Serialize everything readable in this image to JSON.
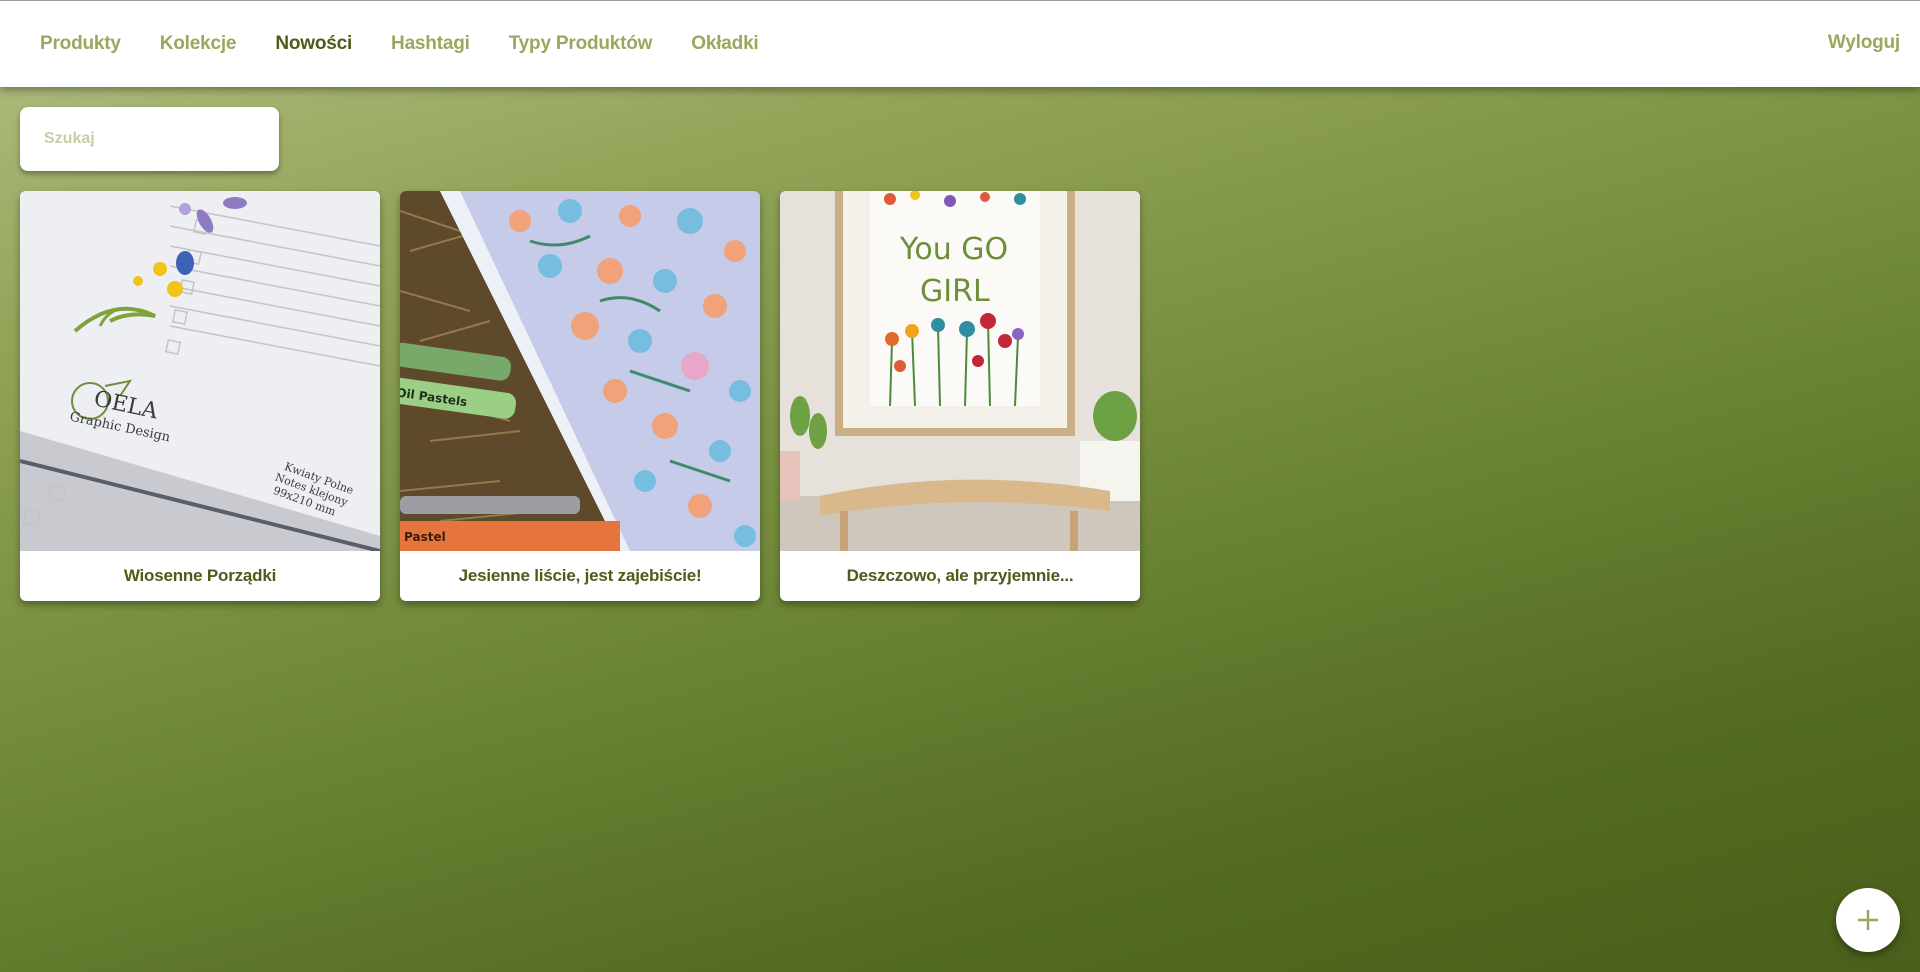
{
  "nav": {
    "items": [
      {
        "label": "Produkty",
        "active": false
      },
      {
        "label": "Kolekcje",
        "active": false
      },
      {
        "label": "Nowości",
        "active": true
      },
      {
        "label": "Hashtagi",
        "active": false
      },
      {
        "label": "Typy Produktów",
        "active": false
      },
      {
        "label": "Okładki",
        "active": false
      }
    ],
    "logout_label": "Wyloguj"
  },
  "search": {
    "placeholder": "Szukaj",
    "value": ""
  },
  "cards": [
    {
      "title": "Wiosenne Porządki",
      "image": {
        "logo_text": "OELA",
        "logo_sub": "Graphic Design",
        "caption_lines": [
          "Kwiaty Polne",
          "Notes klejony",
          "99x210 mm"
        ]
      }
    },
    {
      "title": "Jesienne liście, jest zajebiście!",
      "image": {
        "crayon_labels": [
          "Oil Pastels",
          "Pastel"
        ]
      }
    },
    {
      "title": "Deszczowo, ale przyjemnie...",
      "image": {
        "poster_lines": [
          "You GO",
          "GIRL"
        ]
      }
    }
  ],
  "fab": {
    "icon": "plus-icon"
  },
  "colors": {
    "accent": "#98a85d",
    "active": "#4b5c1b",
    "bg_dark": "#4a5f1b",
    "bg_light": "#b1c084"
  }
}
